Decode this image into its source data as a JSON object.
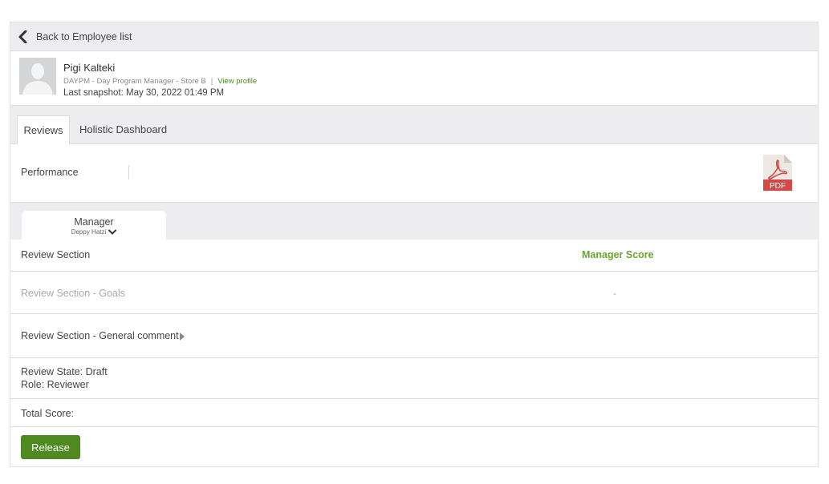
{
  "back": {
    "label": "Back to Employee list",
    "icon": "chevron-left-icon"
  },
  "employee": {
    "name": "Pigi Kalteki",
    "role": "DAYPM - Day Program Manager - Store B",
    "separator": "|",
    "view_profile": "View profile",
    "snapshot": "Last snapshot: May 30, 2022 01:49 PM"
  },
  "tabs": [
    {
      "label": "Reviews",
      "active": true
    },
    {
      "label": "Holistic Dashboard",
      "active": false
    }
  ],
  "performance": {
    "label": "Performance",
    "pdf_label": "PDF"
  },
  "reviewer": {
    "title": "Manager",
    "name": "Deppy Hatzi"
  },
  "table": {
    "header_section": "Review Section",
    "header_score": "Manager Score",
    "goals_label": "Review Section - Goals",
    "goals_score": "-",
    "comment_label": "Review Section - General comment"
  },
  "state": {
    "review_state": "Review State: Draft",
    "role": "Role: Reviewer"
  },
  "total": {
    "label": "Total Score:"
  },
  "actions": {
    "release": "Release"
  },
  "colors": {
    "accent_green": "#4e8a1f",
    "score_green": "#6aa52f",
    "pdf_red": "#d04a4a"
  }
}
